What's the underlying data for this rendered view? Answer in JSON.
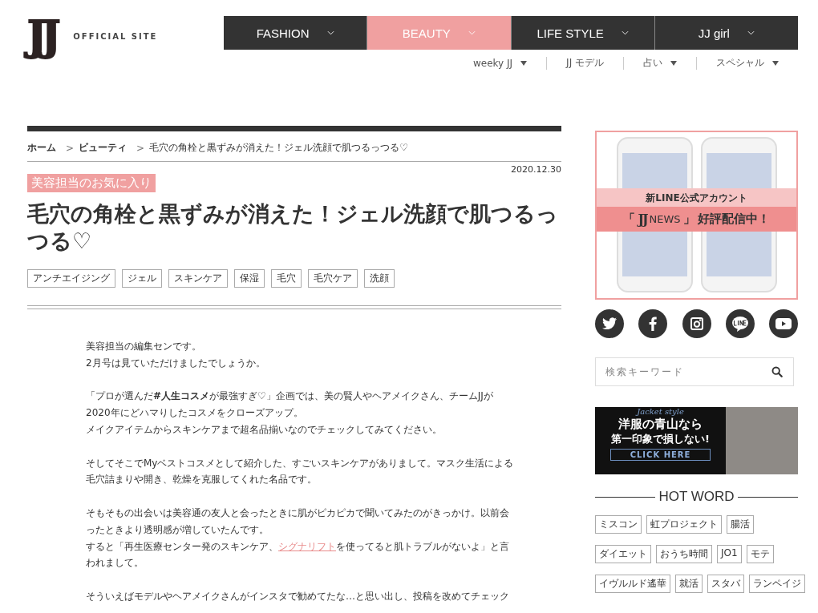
{
  "header": {
    "logo": "JJ",
    "tagline": "OFFICIAL SITE",
    "nav": [
      {
        "label": "FASHION",
        "selected": false
      },
      {
        "label": "BEAUTY",
        "selected": true
      },
      {
        "label": "LIFE STYLE",
        "selected": false
      },
      {
        "label": "JJ girl",
        "selected": false
      }
    ],
    "subnav": [
      {
        "label": "weeky JJ",
        "dropdown": true
      },
      {
        "label": "JJ モデル",
        "dropdown": false
      },
      {
        "label": "占い",
        "dropdown": true
      },
      {
        "label": "スペシャル",
        "dropdown": true
      }
    ]
  },
  "article": {
    "breadcrumb_separator": ">",
    "breadcrumb": [
      "ホーム",
      "ビューティ",
      "毛穴の角栓と黒ずみが消えた！ジェル洗顔で肌つるっつる♡"
    ],
    "date": "2020.12.30",
    "category": "美容担当のお気に入り",
    "title": "毛穴の角栓と黒ずみが消えた！ジェル洗顔で肌つるっつる♡",
    "tags": [
      "アンチエイジング",
      "ジェル",
      "スキンケア",
      "保湿",
      "毛穴",
      "毛穴ケア",
      "洗顔"
    ],
    "paragraphs": [
      [
        [
          {
            "kind": "text",
            "text": "美容担当の編集センです。"
          }
        ],
        [
          {
            "kind": "text",
            "text": "2月号は見ていただけましたでしょうか。"
          }
        ]
      ],
      [
        [
          {
            "kind": "text",
            "text": "「プロが選んだ**#人生コスメ**が最強すぎ♡」企画では、美の賢人やヘアメイクさん、チームJJが2020年にどハマりしたコスメをクローズアップ。"
          }
        ],
        [
          {
            "kind": "text",
            "text": "メイクアイテムからスキンケアまで超名品揃いなのでチェックしてみてください。"
          }
        ]
      ],
      [
        [
          {
            "kind": "text",
            "text": "そしてそこでMyベストコスメとして紹介した、すごいスキンケアがありまして。マスク生活による毛穴詰まりや開き、乾燥を克服してくれた名品です。"
          }
        ]
      ],
      [
        [
          {
            "kind": "text",
            "text": "そもそもの出会いは美容通の友人と会ったときに肌がピカピカで聞いてみたのがきっかけ。以前会ったときより透明感が増していたんです。"
          }
        ],
        [
          {
            "kind": "text",
            "text": "すると「再生医療センター発のスキンケア、"
          },
          {
            "kind": "link",
            "text": "シグナリフト"
          },
          {
            "kind": "text",
            "text": "を使ってると肌トラブルがないよ」と言われまして。"
          }
        ]
      ],
      [
        [
          {
            "kind": "text",
            "text": "そういえばモデルやヘアメイクさんがインスタで勧めてたな…と思い出し、投稿を改めてチェック"
          }
        ]
      ]
    ]
  },
  "sidebar": {
    "line_banner": {
      "lead": "新LINE公式アカウント",
      "brand": "JJ",
      "name": "NEWS",
      "open": "「",
      "close": "」",
      "message": "好評配信中！"
    },
    "social": [
      {
        "kind": "twitter"
      },
      {
        "kind": "facebook"
      },
      {
        "kind": "instagram"
      },
      {
        "kind": "line"
      },
      {
        "kind": "youtube"
      }
    ],
    "search": {
      "placeholder": "検索キーワード"
    },
    "ad_banner": {
      "script": "Jacket style",
      "line1": "洋服の青山なら",
      "line2": "第一印象で損しない!",
      "cta": "CLICK HERE"
    },
    "hot_word": {
      "title": "HOT WORD",
      "tags": [
        "ミスコン",
        "虹プロジェクト",
        "腸活",
        "ダイエット",
        "おうち時間",
        "JO1",
        "モテ",
        "イヴルルド遙華",
        "就活",
        "スタバ",
        "ランペイジ"
      ]
    }
  }
}
